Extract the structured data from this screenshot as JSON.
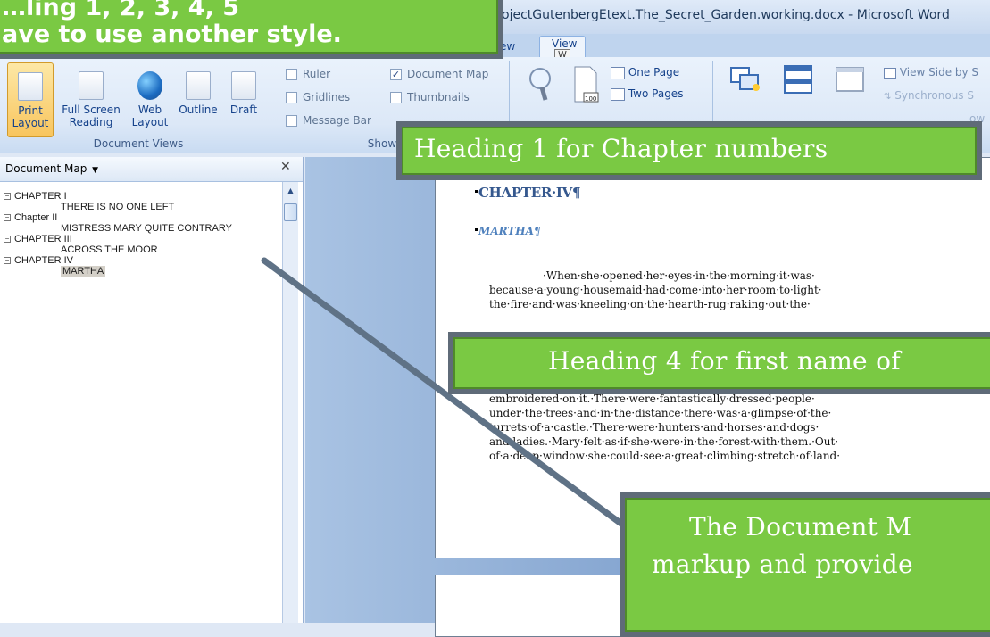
{
  "window": {
    "title": "ojectGutenbergEtext.The_Secret_Garden.working.docx - Microsoft Word"
  },
  "ribbon": {
    "tabs": [
      {
        "label": "ew"
      },
      {
        "label": "View",
        "keytip": "W"
      }
    ],
    "document_views": {
      "group_label": "Document Views",
      "buttons": [
        {
          "label": "Print Layout",
          "line1": "Print",
          "line2": "Layout",
          "selected": true
        },
        {
          "label": "Full Screen Reading",
          "line1": "Full Screen",
          "line2": "Reading"
        },
        {
          "label": "Web Layout",
          "line1": "Web",
          "line2": "Layout"
        },
        {
          "label": "Outline",
          "line1": "Outline",
          "line2": ""
        },
        {
          "label": "Draft",
          "line1": "Draft",
          "line2": ""
        }
      ]
    },
    "show_hide": {
      "group_label": "Show/",
      "checks": [
        {
          "label": "Ruler",
          "checked": false
        },
        {
          "label": "Gridlines",
          "checked": false
        },
        {
          "label": "Message Bar",
          "checked": false
        },
        {
          "label": "Document Map",
          "checked": true
        },
        {
          "label": "Thumbnails",
          "checked": false
        }
      ]
    },
    "zoom": {
      "one_page": "One Page",
      "two_pages": "Two Pages",
      "page_width_badge": "100"
    },
    "window_group": {
      "view_side_by_side": "View Side by S",
      "synchronous": "Synchronous S",
      "ow": "ow"
    }
  },
  "callouts": {
    "top": {
      "line1": "…ling 1, 2, 3, 4, 5",
      "line2": "ave to use another style."
    },
    "heading1": "Heading 1 for Chapter numbers",
    "heading4": "Heading 4 for first name of",
    "docmap": {
      "line1": "The Document M",
      "line2": "markup and provide"
    }
  },
  "document_map": {
    "header": "Document Map",
    "items": [
      {
        "level": 1,
        "text": "CHAPTER I"
      },
      {
        "level": 2,
        "text": "THERE IS NO ONE LEFT"
      },
      {
        "level": 1,
        "text": "Chapter II"
      },
      {
        "level": 2,
        "text": "MISTRESS MARY QUITE CONTRARY"
      },
      {
        "level": 1,
        "text": "CHAPTER III"
      },
      {
        "level": 2,
        "text": "ACROSS THE MOOR"
      },
      {
        "level": 1,
        "text": "CHAPTER IV"
      },
      {
        "level": 2,
        "text": "MARTHA",
        "selected": true
      }
    ]
  },
  "document": {
    "heading1": "CHAPTER·IV¶",
    "heading4": "MARTHA¶",
    "para1": [
      "·When·she·opened·her·eyes·in·the·morning·it·was·",
      "because·a·young·housemaid·had·come·into·her·room·to·light·",
      "the·fire·and·was·kneeling·on·the·hearth-rug·raking·out·the·"
    ],
    "para2": [
      "embroidered·on·it.·There·were·fantastically·dressed·people·",
      "under·the·trees·and·in·the·distance·there·was·a·glimpse·of·the·",
      "turrets·of·a·castle.·There·were·hunters·and·horses·and·dogs·",
      "and·ladies.·Mary·felt·as·if·she·were·in·the·forest·with·them.·Out·",
      "of·a·deep·window·she·could·see·a·great·climbing·stretch·of·land·"
    ]
  }
}
